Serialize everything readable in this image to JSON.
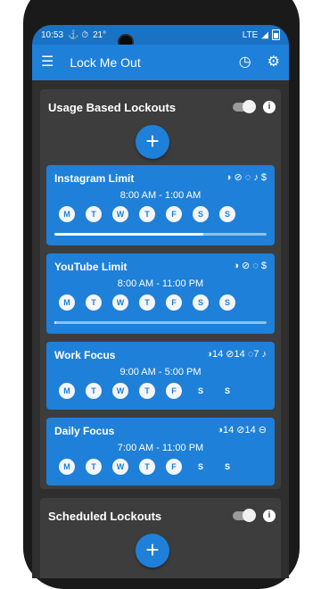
{
  "status_bar": {
    "time": "10:53",
    "icons_left": "⚓ ⏱",
    "temperature": "21°",
    "network": "LTE"
  },
  "app_bar": {
    "title": "Lock Me Out"
  },
  "usage_section": {
    "title": "Usage Based Lockouts",
    "cards": [
      {
        "name": "Instagram Limit",
        "icons": "◑ ⊘ ◌ ♪ $",
        "time": "8:00 AM - 1:00 AM",
        "days": [
          "M",
          "T",
          "W",
          "T",
          "F",
          "S",
          "S"
        ],
        "active": [
          true,
          true,
          true,
          true,
          true,
          true,
          true
        ],
        "progress": 0.7
      },
      {
        "name": "YouTube Limit",
        "icons": "◑ ⊘ ◌ $",
        "time": "8:00 AM - 11:00 PM",
        "days": [
          "M",
          "T",
          "W",
          "T",
          "F",
          "S",
          "S"
        ],
        "active": [
          true,
          true,
          true,
          true,
          true,
          true,
          true
        ],
        "progress": 0.01
      },
      {
        "name": "Work Focus",
        "icons": "◑14 ⊘14 ◌7 ♪",
        "time": "9:00 AM - 5:00 PM",
        "days": [
          "M",
          "T",
          "W",
          "T",
          "F",
          "S",
          "S"
        ],
        "active": [
          true,
          true,
          true,
          true,
          true,
          false,
          false
        ]
      },
      {
        "name": "Daily Focus",
        "icons": "◑14 ⊘14 ⊖",
        "time": "7:00 AM - 11:00 PM",
        "days": [
          "M",
          "T",
          "W",
          "T",
          "F",
          "S",
          "S"
        ],
        "active": [
          true,
          true,
          true,
          true,
          true,
          false,
          false
        ]
      }
    ]
  },
  "scheduled_section": {
    "title": "Scheduled Lockouts"
  },
  "icons": {
    "menu": "☰",
    "clock": "◷",
    "settings": "⚙",
    "info": "i",
    "add": "+"
  }
}
